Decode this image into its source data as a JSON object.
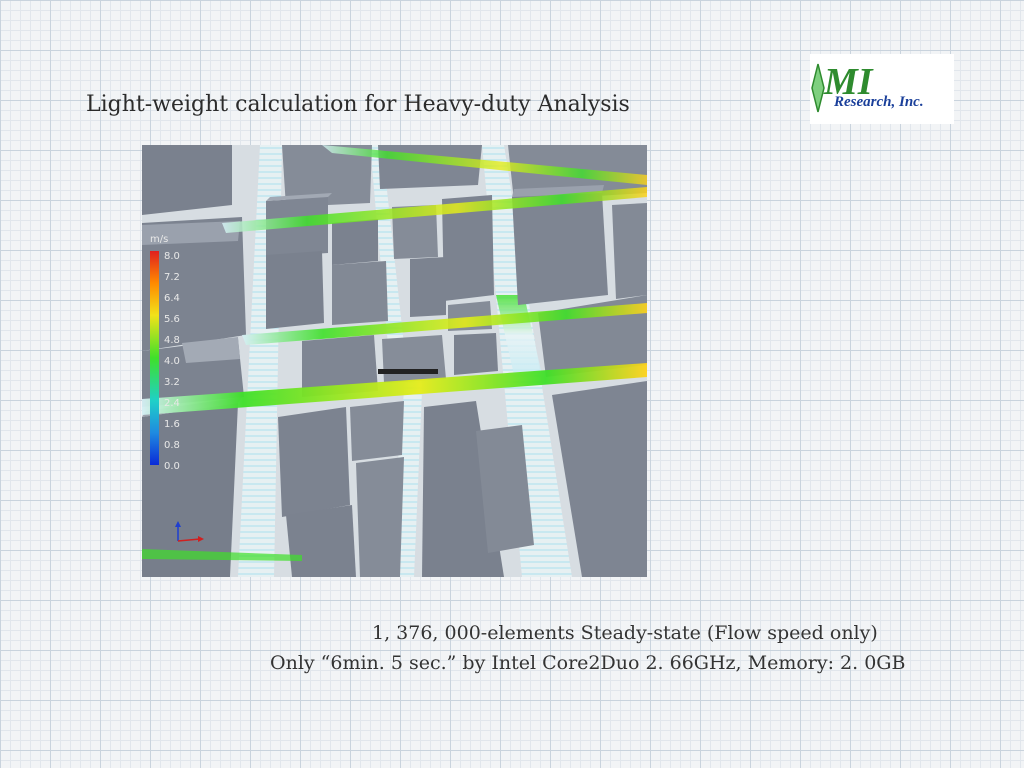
{
  "slide": {
    "title": "Light-weight calculation for Heavy-duty Analysis",
    "caption_line1": "1, 376, 000-elements Steady-state (Flow speed only)",
    "caption_line2": "Only “6min. 5 sec.” by Intel Core2Duo 2. 66GHz, Memory: 2. 0GB"
  },
  "logo": {
    "mark": "MI",
    "text": "Research, Inc.",
    "colors": {
      "mark": "#2e8b2e",
      "text": "#1a3f9a"
    }
  },
  "figure": {
    "legend": {
      "unit": "m/s",
      "ticks": [
        "8.0",
        "7.2",
        "6.4",
        "5.6",
        "4.8",
        "4.0",
        "3.2",
        "2.4",
        "1.6",
        "0.8",
        "0.0"
      ]
    },
    "colors": {
      "building": "#7e8592",
      "building_top": "#9aa1ad",
      "flow_high": "#ffd21a",
      "flow_mid": "#3fe02a",
      "flow_low": "#1fa8d8",
      "flow_zero": "#e8f0f4"
    },
    "icons": [
      "axis-triad-icon"
    ]
  }
}
